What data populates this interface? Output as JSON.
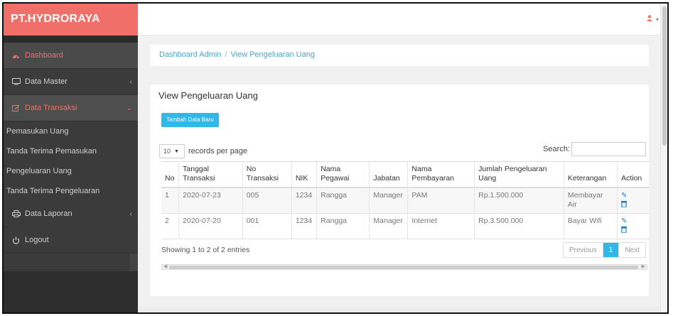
{
  "brand": "PT.HYDRORAYA",
  "sidebar": {
    "items": [
      {
        "label": "Dashboard",
        "icon": "dashboard-gauge-icon"
      },
      {
        "label": "Data Master",
        "icon": "monitor-icon"
      },
      {
        "label": "Data Transaksi",
        "icon": "edit-icon"
      },
      {
        "label": "Data Laporan",
        "icon": "print-icon"
      },
      {
        "label": "Logout",
        "icon": "power-icon"
      }
    ],
    "sub_items": [
      "Pemasukan Uang",
      "Tanda Terima Pemasukan",
      "Pengeluaran Uang",
      "Tanda Terima Pengeluaran"
    ]
  },
  "breadcrumb": {
    "home": "Dashboard Admin",
    "separator": "/",
    "current": "View Pengeluaran Uang"
  },
  "card": {
    "title": "View Pengeluaran Uang",
    "add_button": "Tambah Data Baru",
    "length_value": "10",
    "length_suffix": "records per page",
    "search_label": "Search:",
    "search_value": ""
  },
  "table": {
    "headers": [
      "No",
      "Tanggal Transaksi",
      "No Transaksi",
      "NIK",
      "Nama Pegawai",
      "Jabatan",
      "Nama Pembayaran",
      "Jumlah Pengeluaran Uang",
      "Keterangan",
      "Action"
    ],
    "rows": [
      [
        "1",
        "2020-07-23",
        "005",
        "1234",
        "Rangga",
        "Manager",
        "PAM",
        "Rp.1.500.000",
        "Membayar Air"
      ],
      [
        "2",
        "2020-07-20",
        "001",
        "1234",
        "Rangga",
        "Manager",
        "Internet",
        "Rp.3.500.000",
        "Bayar Wifi"
      ]
    ]
  },
  "info": "Showing 1 to 2 of 2 entries",
  "pager": {
    "prev": "Previous",
    "current": "1",
    "next": "Next"
  },
  "colors": {
    "brand": "#f06f68",
    "sidebar": "#3b3b3b",
    "accent": "#30b8e8",
    "link": "#4da3c9"
  }
}
